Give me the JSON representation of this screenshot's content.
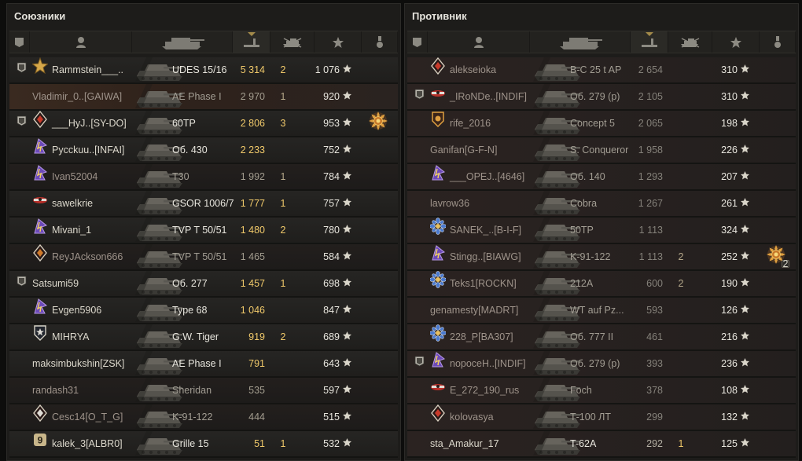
{
  "allies": {
    "title": "Союзники",
    "rows": [
      {
        "name": "Rammstein___..",
        "vehicle": "UDES 15/16",
        "damage": "5 314",
        "frags": "2",
        "xp": "1 076",
        "platoon": true,
        "clan": "star-gold",
        "state": "alive",
        "medal": null
      },
      {
        "name": "Vladimir_0..[GAIWA]",
        "vehicle": "AE Phase I",
        "damage": "2 970",
        "frags": "1",
        "xp": "920",
        "platoon": false,
        "clan": null,
        "state": "self-dead",
        "medal": null
      },
      {
        "name": "___HyJ..[SY-DO]",
        "vehicle": "60TP",
        "damage": "2 806",
        "frags": "3",
        "xp": "953",
        "platoon": true,
        "clan": "diamond-red",
        "state": "alive",
        "medal": "sun-medal"
      },
      {
        "name": "Pycckuu..[INFAI]",
        "vehicle": "Об. 430",
        "damage": "2 233",
        "frags": "",
        "xp": "752",
        "platoon": false,
        "clan": "purple-lightning",
        "state": "alive",
        "medal": null
      },
      {
        "name": "Ivan52004",
        "vehicle": "T30",
        "damage": "1 992",
        "frags": "1",
        "xp": "784",
        "platoon": false,
        "clan": "purple-lightning",
        "state": "dead",
        "medal": null
      },
      {
        "name": "sawelkrie",
        "vehicle": "GSOR 1006/7",
        "damage": "1 777",
        "frags": "1",
        "xp": "757",
        "platoon": false,
        "clan": "red-plane",
        "state": "alive",
        "medal": null
      },
      {
        "name": "Mivani_1",
        "vehicle": "TVP T 50/51",
        "damage": "1 480",
        "frags": "2",
        "xp": "780",
        "platoon": false,
        "clan": "purple-lightning",
        "state": "alive",
        "medal": null
      },
      {
        "name": "ReyJAckson666",
        "vehicle": "TVP T 50/51",
        "damage": "1 465",
        "frags": "",
        "xp": "584",
        "platoon": false,
        "clan": "diamond-orange",
        "state": "dead",
        "medal": null
      },
      {
        "name": "Satsumi59",
        "vehicle": "Об. 277",
        "damage": "1 457",
        "frags": "1",
        "xp": "698",
        "platoon": true,
        "clan": null,
        "state": "alive",
        "medal": null
      },
      {
        "name": "Evgen5906",
        "vehicle": "Type 68",
        "damage": "1 046",
        "frags": "",
        "xp": "847",
        "platoon": false,
        "clan": "purple-lightning",
        "state": "alive",
        "medal": null
      },
      {
        "name": "MIHRYA",
        "vehicle": "G.W. Tiger",
        "damage": "919",
        "frags": "2",
        "xp": "689",
        "platoon": false,
        "clan": "shield-star",
        "state": "alive",
        "medal": null
      },
      {
        "name": "maksimbukshin[ZSK]",
        "vehicle": "AE Phase I",
        "damage": "791",
        "frags": "",
        "xp": "643",
        "platoon": false,
        "clan": null,
        "state": "alive",
        "medal": null
      },
      {
        "name": "randash31",
        "vehicle": "Sheridan",
        "damage": "535",
        "frags": "",
        "xp": "597",
        "platoon": false,
        "clan": null,
        "state": "dead",
        "medal": null
      },
      {
        "name": "Cesc14[O_T_G]",
        "vehicle": "K-91-122",
        "damage": "444",
        "frags": "",
        "xp": "515",
        "platoon": false,
        "clan": "diamond-white",
        "state": "dead",
        "medal": null
      },
      {
        "name": "kalek_3[ALBR0]",
        "vehicle": "Grille 15",
        "damage": "51",
        "frags": "1",
        "xp": "532",
        "platoon": false,
        "clan": "badge-9",
        "state": "alive",
        "medal": null
      }
    ]
  },
  "enemies": {
    "title": "Противник",
    "rows": [
      {
        "name": "alekseioka",
        "vehicle": "В-С 25 t AP",
        "damage": "2 654",
        "frags": "",
        "xp": "310",
        "platoon": false,
        "clan": "diamond-red",
        "state": "dead",
        "medal": null
      },
      {
        "name": "_IRoNDe..[INDIF]",
        "vehicle": "Об. 279 (р)",
        "damage": "2 105",
        "frags": "",
        "xp": "310",
        "platoon": true,
        "clan": "red-plane",
        "state": "dead",
        "medal": null
      },
      {
        "name": "rife_2016",
        "vehicle": "Concept 5",
        "damage": "2 065",
        "frags": "",
        "xp": "198",
        "platoon": false,
        "clan": "shield-gold",
        "state": "dead",
        "medal": null
      },
      {
        "name": "Ganifan[G-F-N]",
        "vehicle": "S. Conqueror",
        "damage": "1 958",
        "frags": "",
        "xp": "226",
        "platoon": false,
        "clan": null,
        "state": "dead",
        "medal": null
      },
      {
        "name": "___OPEJ..[4646]",
        "vehicle": "Об. 140",
        "damage": "1 293",
        "frags": "",
        "xp": "207",
        "platoon": false,
        "clan": "purple-lightning",
        "state": "dead",
        "medal": null
      },
      {
        "name": "lavrow36",
        "vehicle": "Cobra",
        "damage": "1 267",
        "frags": "",
        "xp": "261",
        "platoon": false,
        "clan": null,
        "state": "dead",
        "medal": null
      },
      {
        "name": "SANEK_..[B-I-F]",
        "vehicle": "50TP",
        "damage": "1 113",
        "frags": "",
        "xp": "324",
        "platoon": false,
        "clan": "flower-blue",
        "state": "dead",
        "medal": null
      },
      {
        "name": "Stingg..[BIAWG]",
        "vehicle": "K-91-122",
        "damage": "1 113",
        "frags": "2",
        "xp": "252",
        "platoon": false,
        "clan": "purple-lightning",
        "state": "dead",
        "medal": "sun-medal-2"
      },
      {
        "name": "Teks1[ROCKN]",
        "vehicle": "212A",
        "damage": "600",
        "frags": "2",
        "xp": "190",
        "platoon": false,
        "clan": "flower-blue",
        "state": "dead",
        "medal": null
      },
      {
        "name": "genamesty[MADRT]",
        "vehicle": "WT auf Pz...",
        "damage": "593",
        "frags": "",
        "xp": "126",
        "platoon": false,
        "clan": null,
        "state": "dead",
        "medal": null
      },
      {
        "name": "228_P[BA307]",
        "vehicle": "Об. 777 II",
        "damage": "461",
        "frags": "",
        "xp": "216",
        "platoon": false,
        "clan": "flower-blue",
        "state": "dead",
        "medal": null
      },
      {
        "name": "nopoceH..[INDIF]",
        "vehicle": "Об. 279 (р)",
        "damage": "393",
        "frags": "",
        "xp": "236",
        "platoon": true,
        "clan": "purple-lightning",
        "state": "dead",
        "medal": null
      },
      {
        "name": "E_272_190_rus",
        "vehicle": "Foch",
        "damage": "378",
        "frags": "",
        "xp": "108",
        "platoon": false,
        "clan": "red-plane",
        "state": "dead",
        "medal": null
      },
      {
        "name": "kolovasya",
        "vehicle": "Т-100 ЛТ",
        "damage": "299",
        "frags": "",
        "xp": "132",
        "platoon": false,
        "clan": "diamond-red",
        "state": "dead",
        "medal": null
      },
      {
        "name": "sta_Amakur_17",
        "vehicle": "T-62A",
        "damage": "292",
        "frags": "1",
        "xp": "125",
        "platoon": false,
        "clan": null,
        "state": "alive",
        "medal": null
      }
    ]
  },
  "medal_count_badge": "2",
  "columns": [
    "squad-icon",
    "player-icon",
    "vehicle-icon",
    "damage-icon",
    "frags-icon",
    "xp-star-icon",
    "medal-icon"
  ],
  "colors": {
    "damage_gold": "#f0c96a",
    "text": "#dcd8cc",
    "dead_text": "#9e938a",
    "panel": "#1d1c1a"
  }
}
